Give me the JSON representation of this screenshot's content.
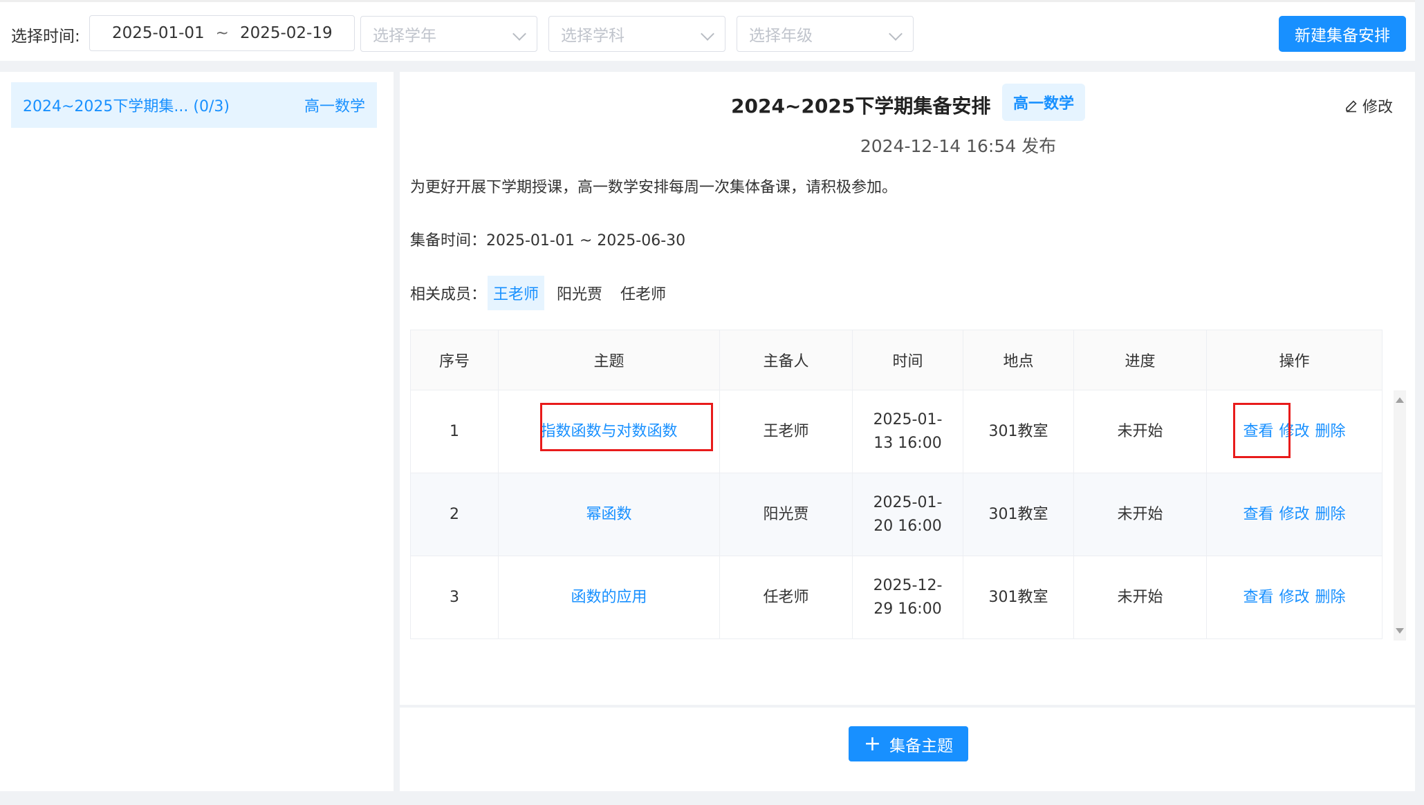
{
  "filter": {
    "time_label": "选择时间:",
    "date_start": "2025-01-01",
    "date_sep": "~",
    "date_end": "2025-02-19",
    "year_placeholder": "选择学年",
    "subject_placeholder": "选择学科",
    "grade_placeholder": "选择年级",
    "new_button": "新建集备安排"
  },
  "sidebar": {
    "items": [
      {
        "label": "2024~2025下学期集... (0/3)",
        "tag": "高一数学"
      }
    ]
  },
  "detail": {
    "title": "2024~2025下学期集备安排",
    "tag": "高一数学",
    "edit_label": "修改",
    "publish_time": "2024-12-14 16:54 发布",
    "description": "为更好开展下学期授课，高一数学安排每周一次集体备课，请积极参加。",
    "time_row": "集备时间：2025-01-01 ~ 2025-06-30",
    "members_label": "相关成员：",
    "members": [
      "王老师",
      "阳光贾",
      "任老师"
    ]
  },
  "table": {
    "headers": [
      "序号",
      "主题",
      "主备人",
      "时间",
      "地点",
      "进度",
      "操作"
    ],
    "rows": [
      {
        "no": "1",
        "topic": "指数函数与对数函数",
        "owner": "王老师",
        "time_line1": "2025-01-",
        "time_line2": "13 16:00",
        "place": "301教室",
        "status": "未开始"
      },
      {
        "no": "2",
        "topic": "幂函数",
        "owner": "阳光贾",
        "time_line1": "2025-01-",
        "time_line2": "20 16:00",
        "place": "301教室",
        "status": "未开始"
      },
      {
        "no": "3",
        "topic": "函数的应用",
        "owner": "任老师",
        "time_line1": "2025-12-",
        "time_line2": "29 16:00",
        "place": "301教室",
        "status": "未开始"
      }
    ],
    "op_view": "查看",
    "op_edit": "修改",
    "op_delete": "删除"
  },
  "footer": {
    "add_button": "集备主题",
    "add_icon": "+"
  },
  "colors": {
    "accent": "#1890ff",
    "highlight": "#e81b1b"
  }
}
